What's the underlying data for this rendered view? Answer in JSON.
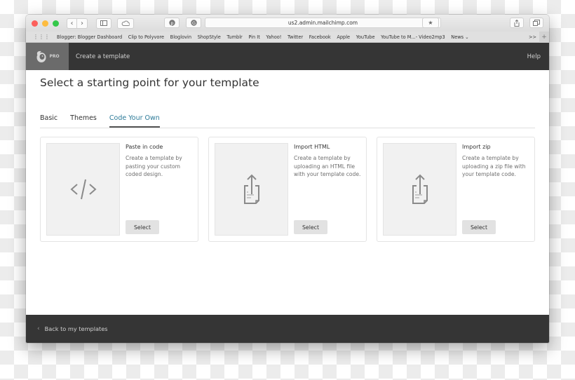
{
  "browser": {
    "url": "us2.admin.mailchimp.com",
    "toolbar_icons": [
      "back-icon",
      "forward-icon",
      "sidebar-icon",
      "cloud-icon",
      "pinterest-icon",
      "grammarly-icon",
      "reload-icon",
      "bookmark-icon",
      "share-icon",
      "tabs-icon"
    ],
    "bookmarks": [
      "Blogger: Blogger Dashboard",
      "Clip to Polyvore",
      "Bloglovin",
      "ShopStyle",
      "Tumblr",
      "Pin It",
      "Yahoo!",
      "Twitter",
      "Facebook",
      "Apple",
      "YouTube",
      "YouTube to M...- Video2mp3",
      "News ⌄"
    ],
    "bookmarks_more": ">>",
    "new_tab": "+"
  },
  "app": {
    "logo_badge": "PRO",
    "header_title": "Create a template",
    "help_label": "Help"
  },
  "main": {
    "page_title": "Select a starting point for your template",
    "tabs": [
      {
        "label": "Basic",
        "active": false
      },
      {
        "label": "Themes",
        "active": false
      },
      {
        "label": "Code Your Own",
        "active": true
      }
    ],
    "cards": [
      {
        "icon": "code-icon",
        "title": "Paste in code",
        "description": "Create a template by pasting your custom coded design.",
        "button": "Select"
      },
      {
        "icon": "upload-file-icon",
        "title": "Import HTML",
        "description": "Create a template by uploading an HTML file with your template code.",
        "button": "Select"
      },
      {
        "icon": "upload-file-icon",
        "title": "Import zip",
        "description": "Create a template by uploading a zip file with your template code.",
        "button": "Select"
      }
    ]
  },
  "footer": {
    "back_label": "Back to my templates"
  },
  "colors": {
    "accent_tab": "#2c7a98",
    "header_bg": "#353535",
    "logo_bg": "#6b6b6b"
  }
}
